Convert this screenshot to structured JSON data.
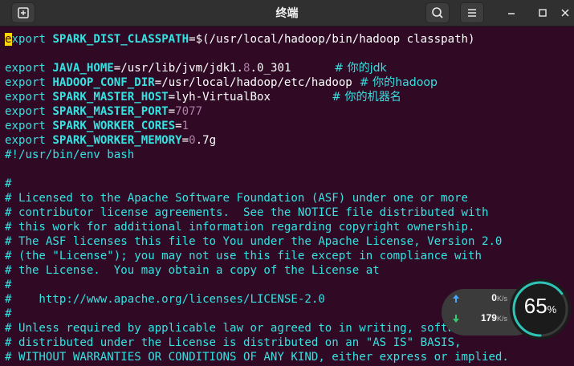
{
  "window": {
    "title": "终端"
  },
  "icons": {
    "new_tab": "new-tab-icon",
    "search": "search-icon",
    "menu": "hamburger-menu-icon",
    "minimize": "minimize-icon",
    "maximize": "maximize-icon",
    "close": "close-icon"
  },
  "terminal": {
    "lines": [
      {
        "kw": "export",
        "var": "SPARK_DIST_CLASSPATH",
        "eq": "=",
        "val": "$(/usr/local/hadoop/bin/hadoop classpath)",
        "num": "",
        "val2": "",
        "cmt": ""
      },
      {
        "kw": "",
        "var": "",
        "eq": "",
        "val": "",
        "num": "",
        "val2": "",
        "cmt": ""
      },
      {
        "kw": "export",
        "var": "JAVA_HOME",
        "eq": "=",
        "val": "/usr/lib/jvm/jdk1.",
        "num": "8",
        "val2": ".0_301",
        "cmt": "            # 你的jdk"
      },
      {
        "kw": "export",
        "var": "HADOOP_CONF_DIR",
        "eq": "=",
        "val": "/usr/local/hadoop/etc/hadoop",
        "num": "",
        "val2": "",
        "cmt": "  # 你的hadoop"
      },
      {
        "kw": "export",
        "var": "SPARK_MASTER_HOST",
        "eq": "=",
        "val": "lyh-VirtualBox",
        "num": "",
        "val2": "",
        "cmt": "                 # 你的机器名"
      },
      {
        "kw": "export",
        "var": "SPARK_MASTER_PORT",
        "eq": "=",
        "val": "",
        "num": "7077",
        "val2": "",
        "cmt": ""
      },
      {
        "kw": "export",
        "var": "SPARK_WORKER_CORES",
        "eq": "=",
        "val": "",
        "num": "1",
        "val2": "",
        "cmt": ""
      },
      {
        "kw": "export",
        "var": "SPARK_WORKER_MEMORY",
        "eq": "=",
        "val": "",
        "num": "0",
        "val2": ".7g",
        "cmt": ""
      },
      {
        "kw": "",
        "var": "",
        "eq": "",
        "val": "",
        "num": "",
        "val2": "",
        "cmt": "#!/usr/bin/env bash"
      },
      {
        "kw": "",
        "var": "",
        "eq": "",
        "val": "",
        "num": "",
        "val2": "",
        "cmt": ""
      },
      {
        "kw": "",
        "var": "",
        "eq": "",
        "val": "",
        "num": "",
        "val2": "",
        "cmt": "#"
      },
      {
        "kw": "",
        "var": "",
        "eq": "",
        "val": "",
        "num": "",
        "val2": "",
        "cmt": "# Licensed to the Apache Software Foundation (ASF) under one or more"
      },
      {
        "kw": "",
        "var": "",
        "eq": "",
        "val": "",
        "num": "",
        "val2": "",
        "cmt": "# contributor license agreements.  See the NOTICE file distributed with"
      },
      {
        "kw": "",
        "var": "",
        "eq": "",
        "val": "",
        "num": "",
        "val2": "",
        "cmt": "# this work for additional information regarding copyright ownership."
      },
      {
        "kw": "",
        "var": "",
        "eq": "",
        "val": "",
        "num": "",
        "val2": "",
        "cmt": "# The ASF licenses this file to You under the Apache License, Version 2.0"
      },
      {
        "kw": "",
        "var": "",
        "eq": "",
        "val": "",
        "num": "",
        "val2": "",
        "cmt": "# (the \"License\"); you may not use this file except in compliance with"
      },
      {
        "kw": "",
        "var": "",
        "eq": "",
        "val": "",
        "num": "",
        "val2": "",
        "cmt": "# the License.  You may obtain a copy of the License at"
      },
      {
        "kw": "",
        "var": "",
        "eq": "",
        "val": "",
        "num": "",
        "val2": "",
        "cmt": "#"
      },
      {
        "kw": "",
        "var": "",
        "eq": "",
        "val": "",
        "num": "",
        "val2": "",
        "cmt": "#    http://www.apache.org/licenses/LICENSE-2.0"
      },
      {
        "kw": "",
        "var": "",
        "eq": "",
        "val": "",
        "num": "",
        "val2": "",
        "cmt": "#"
      },
      {
        "kw": "",
        "var": "",
        "eq": "",
        "val": "",
        "num": "",
        "val2": "",
        "cmt": "# Unless required by applicable law or agreed to in writing, software"
      },
      {
        "kw": "",
        "var": "",
        "eq": "",
        "val": "",
        "num": "",
        "val2": "",
        "cmt": "# distributed under the License is distributed on an \"AS IS\" BASIS,"
      },
      {
        "kw": "",
        "var": "",
        "eq": "",
        "val": "",
        "num": "",
        "val2": "",
        "cmt": "# WITHOUT WARRANTIES OR CONDITIONS OF ANY KIND, either express or implied."
      }
    ]
  },
  "net_widget": {
    "upload_value": "0",
    "upload_unit": "K/s",
    "download_value": "179",
    "download_unit": "K/s",
    "usage_percent": "65",
    "usage_suffix": "%",
    "usage_fraction": 0.65,
    "colors": {
      "up_arrow": "#4aa8ff",
      "down_arrow": "#37c871",
      "ring": "#2ec4b6"
    }
  },
  "colors": {
    "terminal_bg": "#300a24",
    "keyword": "#34e2e2",
    "number": "#ad7fa8",
    "cursor": "#ffd700"
  }
}
